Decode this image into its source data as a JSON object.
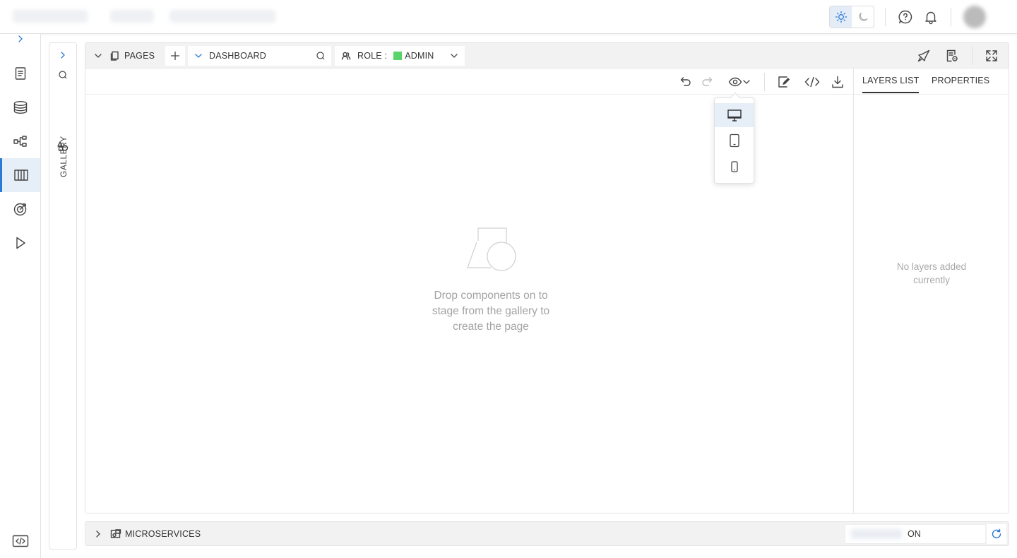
{
  "theme": {
    "accent": "#2b7bd6",
    "active_bg": "#e6eef7",
    "role_color": "#5ad36b"
  },
  "gallery": {
    "label": "GALLERY"
  },
  "mainbar": {
    "pages_label": "PAGES",
    "page_name": "DASHBOARD",
    "role_label": "ROLE :",
    "role_value": "ADMIN"
  },
  "right_panel": {
    "tabs": [
      {
        "label": "LAYERS LIST",
        "selected": true
      },
      {
        "label": "PROPERTIES",
        "selected": false
      }
    ],
    "empty_text": "No layers added currently"
  },
  "canvas": {
    "empty_text": "Drop components on to stage from the gallery to create the page"
  },
  "preview_dropdown": {
    "items": [
      "desktop-icon",
      "tablet-icon",
      "mobile-icon"
    ],
    "selected": "desktop-icon"
  },
  "bottombar": {
    "label": "MICROSERVICES",
    "status": "ON"
  }
}
